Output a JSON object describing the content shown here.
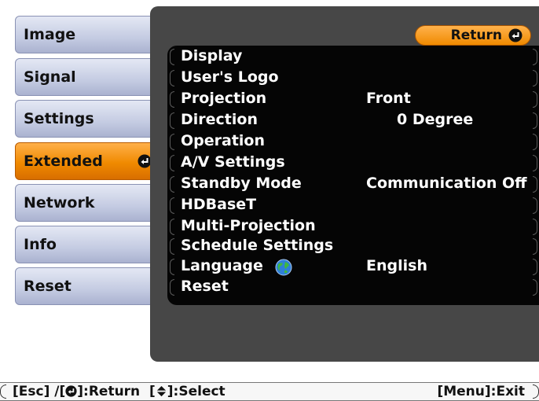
{
  "tabs": [
    {
      "label": "Image"
    },
    {
      "label": "Signal"
    },
    {
      "label": "Settings"
    },
    {
      "label": "Extended",
      "active": true
    },
    {
      "label": "Network"
    },
    {
      "label": "Info"
    },
    {
      "label": "Reset"
    }
  ],
  "return_label": "Return",
  "menu": [
    {
      "label": "Display",
      "value": ""
    },
    {
      "label": "User's Logo",
      "value": ""
    },
    {
      "label": "Projection",
      "value": "Front"
    },
    {
      "label": "Direction",
      "value": "0 Degree"
    },
    {
      "label": "Operation",
      "value": ""
    },
    {
      "label": "A/V Settings",
      "value": ""
    },
    {
      "label": "Standby Mode",
      "value": "Communication Off"
    },
    {
      "label": "HDBaseT",
      "value": ""
    },
    {
      "label": "Multi-Projection",
      "value": ""
    },
    {
      "label": "Schedule Settings",
      "value": ""
    },
    {
      "label": "Language",
      "value": "English",
      "icon": "globe-icon"
    },
    {
      "label": "Reset",
      "value": ""
    }
  ],
  "footer": {
    "esc": "[Esc] /[",
    "return": "]:Return",
    "select_open": "[",
    "select": "]:Select",
    "menu_exit": "[Menu]:Exit"
  },
  "colors": {
    "accent": "#f08a00",
    "tab": "#c4cbe2",
    "panel": "#474747",
    "menu_bg": "#050505"
  }
}
